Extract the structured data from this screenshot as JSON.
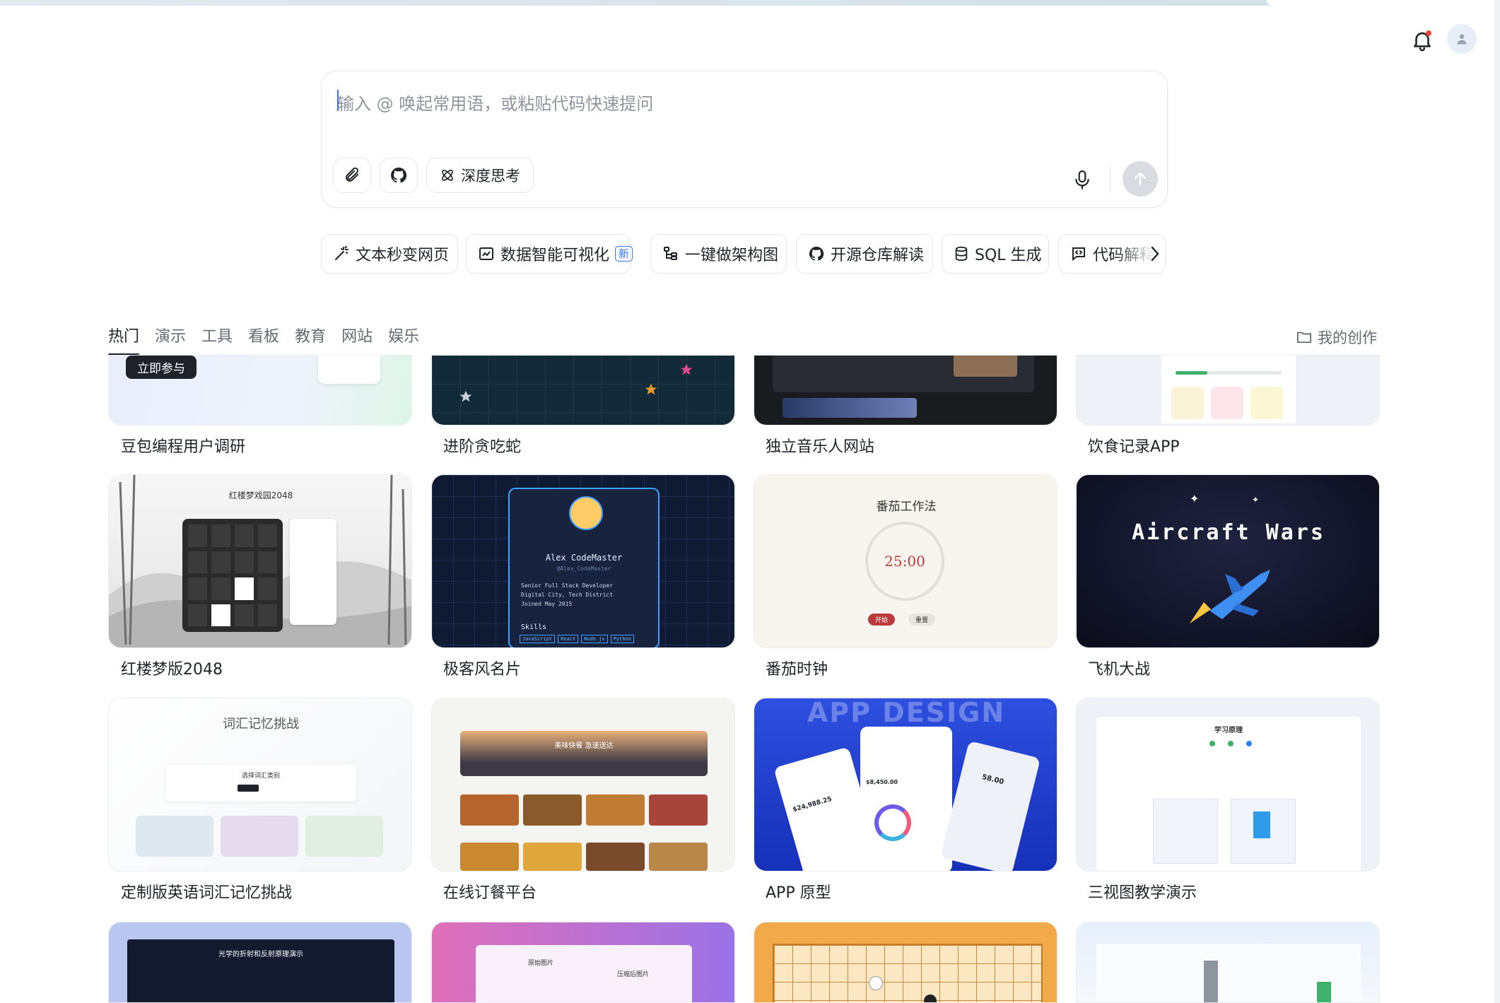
{
  "composer": {
    "placeholder": "输入 @ 唤起常用语，或粘贴代码快速提问",
    "deep_think_label": "深度思考"
  },
  "chips": [
    {
      "label": "文本秒变网页"
    },
    {
      "label": "数据智能可视化",
      "badge": "新"
    },
    {
      "label": "一键做架构图"
    },
    {
      "label": "开源仓库解读"
    },
    {
      "label": "SQL 生成"
    },
    {
      "label": "代码解释"
    }
  ],
  "tabs": [
    "热门",
    "演示",
    "工具",
    "看板",
    "教育",
    "网站",
    "娱乐"
  ],
  "my_creations": "我的创作",
  "cards": [
    {
      "title": "豆包编程用户调研",
      "overlay": "立即参与"
    },
    {
      "title": "进阶贪吃蛇"
    },
    {
      "title": "独立音乐人网站"
    },
    {
      "title": "饮食记录APP"
    },
    {
      "title": "红楼梦版2048",
      "thumb": {
        "heading": "红楼梦戏园2048"
      }
    },
    {
      "title": "极客风名片",
      "thumb": {
        "name": "Alex CodeMaster",
        "handle": "@Alex_CodeMaster",
        "lines": [
          "Senior Full Stack Developer",
          "Digital City, Tech District",
          "Joined May 2015"
        ],
        "skills_label": "Skills",
        "skills": [
          "JavaScript",
          "React",
          "Node.js",
          "Python"
        ]
      }
    },
    {
      "title": "番茄时钟",
      "thumb": {
        "heading": "番茄工作法",
        "time": "25:00",
        "start": "开始",
        "reset": "重置"
      }
    },
    {
      "title": "飞机大战",
      "thumb": {
        "heading": "Aircraft Wars"
      }
    },
    {
      "title": "定制版英语词汇记忆挑战",
      "thumb": {
        "heading": "词汇记忆挑战",
        "sub": "选择词汇类别"
      }
    },
    {
      "title": "在线订餐平台",
      "thumb": {
        "banner": "美味快餐 急速送达"
      }
    },
    {
      "title": "APP 原型",
      "thumb": {
        "heading": "APP DESIGN",
        "v1": "$24,988.25",
        "v2": "$8,450.00",
        "v3": "58.00"
      }
    },
    {
      "title": "三视图教学演示",
      "thumb": {
        "heading": "学习原理"
      }
    },
    {
      "title": "",
      "thumb": {
        "heading": "光学的折射和反射原理演示"
      }
    },
    {
      "title": "",
      "thumb": {
        "left": "原始图片",
        "right": "压缩后图片"
      }
    },
    {
      "title": ""
    },
    {
      "title": ""
    }
  ],
  "colors": {
    "accent": "#3370ff",
    "notify": "#f0453a",
    "text": "#1f2329",
    "muted": "#646a73"
  }
}
